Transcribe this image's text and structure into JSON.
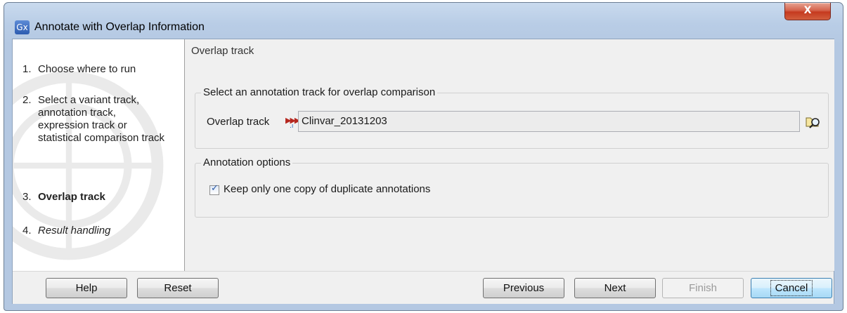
{
  "window": {
    "icon_text": "Gx",
    "title": "Annotate with Overlap Information",
    "close_label": "X"
  },
  "steps": [
    {
      "num": "1.",
      "label": "Choose where to run",
      "state": "done"
    },
    {
      "num": "2.",
      "label": "Select a variant track, annotation track, expression track or statistical comparison track",
      "state": "done"
    },
    {
      "num": "3.",
      "label": "Overlap track",
      "state": "active"
    },
    {
      "num": "4.",
      "label": "Result handling",
      "state": "pending"
    }
  ],
  "content": {
    "section_title": "Overlap track",
    "track_group": {
      "title": "Select an annotation track for overlap comparison",
      "field_label": "Overlap track",
      "field_value": "Clinvar_20131203"
    },
    "options_group": {
      "title": "Annotation options",
      "checkbox_label": "Keep only one copy of duplicate annotations",
      "checkbox_checked": true
    }
  },
  "buttons": {
    "help": "Help",
    "reset": "Reset",
    "previous": "Previous",
    "next": "Next",
    "finish": "Finish",
    "cancel": "Cancel"
  }
}
